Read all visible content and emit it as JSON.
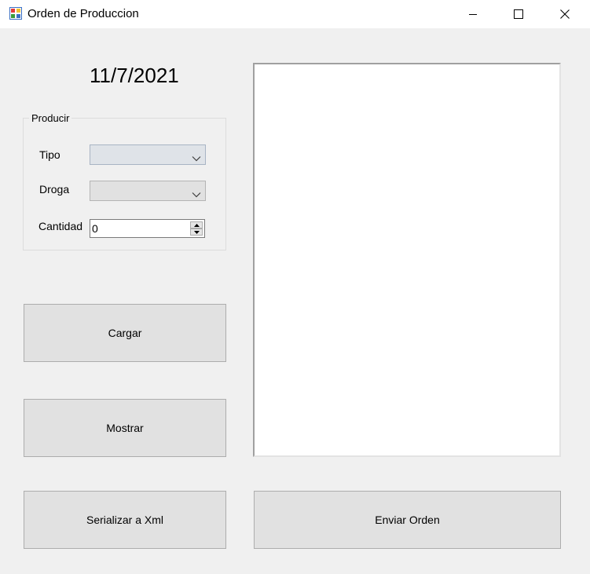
{
  "window": {
    "title": "Orden de Produccion",
    "controls": {
      "minimize": "minimize-icon",
      "maximize": "maximize-icon",
      "close": "close-icon"
    }
  },
  "header": {
    "date": "11/7/2021"
  },
  "producir": {
    "group_title": "Producir",
    "tipo": {
      "label": "Tipo",
      "value": ""
    },
    "droga": {
      "label": "Droga",
      "value": ""
    },
    "cantidad": {
      "label": "Cantidad",
      "value": "0"
    }
  },
  "buttons": {
    "cargar": "Cargar",
    "mostrar": "Mostrar",
    "serializar": "Serializar a Xml",
    "enviar": "Enviar Orden"
  },
  "list": {
    "items": []
  },
  "colors": {
    "window_bg": "#f0f0f0",
    "titlebar_bg": "#ffffff",
    "button_bg": "#e1e1e1",
    "button_border": "#adadad"
  }
}
